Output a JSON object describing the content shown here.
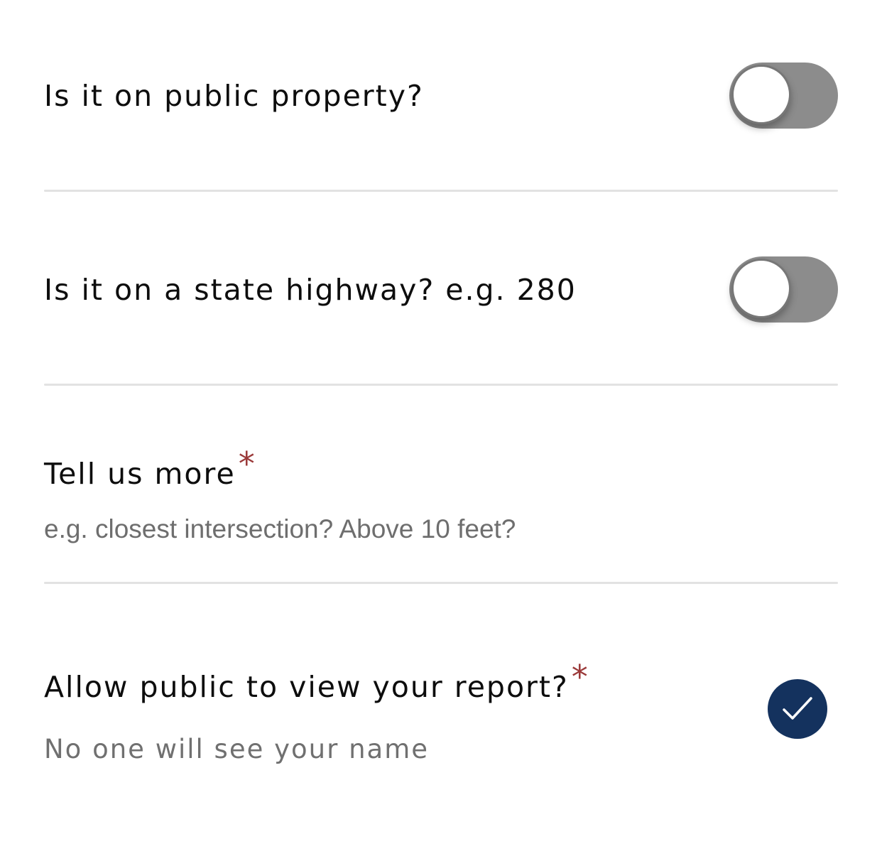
{
  "form": {
    "public_property": {
      "label": "Is it on public property?",
      "toggle_on": false
    },
    "state_highway": {
      "label": "Is it on a state highway? e.g. 280",
      "toggle_on": false
    },
    "tell_us_more": {
      "label": "Tell us more",
      "required_mark": "*",
      "placeholder": "e.g. closest intersection? Above 10 feet?",
      "value": ""
    },
    "allow_public": {
      "label": "Allow public to view your report?",
      "required_mark": "*",
      "sublabel": "No one will see your name",
      "checked": true
    }
  },
  "colors": {
    "toggle_off": "#8c8c8c",
    "check_fill": "#14325e",
    "required": "#9b3a3a",
    "divider": "#e2e2e2"
  },
  "icons": {
    "checkmark": "check-icon"
  }
}
